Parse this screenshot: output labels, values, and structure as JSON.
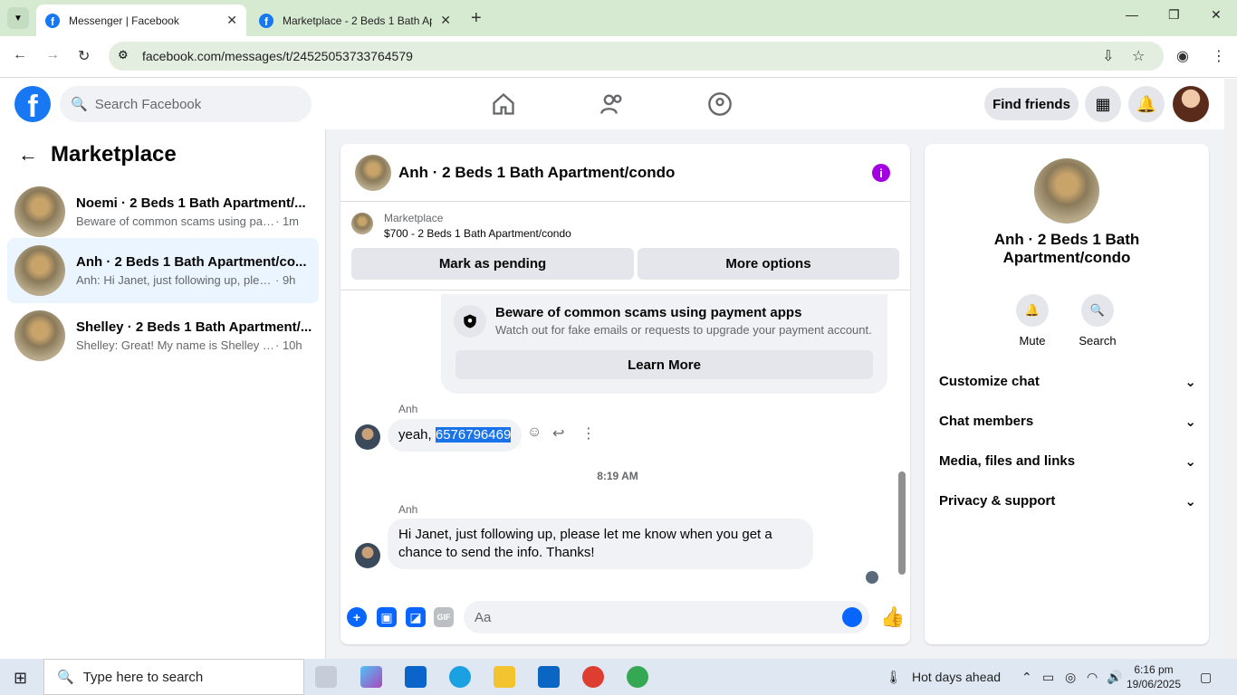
{
  "browser": {
    "tabs": [
      {
        "title": "Messenger | Facebook",
        "active": true
      },
      {
        "title": "Marketplace - 2 Beds 1 Bath Ap",
        "active": false
      }
    ],
    "url": "facebook.com/messages/t/24525053733764579"
  },
  "fb_header": {
    "search_placeholder": "Search Facebook",
    "find_friends": "Find friends"
  },
  "left": {
    "title": "Marketplace",
    "conversations": [
      {
        "name": "Noemi · 2 Beds 1 Bath Apartment/...",
        "preview": "Beware of common scams using pay...",
        "time": "· 1m",
        "selected": false
      },
      {
        "name": "Anh · 2 Beds 1 Bath Apartment/co...",
        "preview": "Anh: Hi Janet, just following up, pleas...",
        "time": "· 9h",
        "selected": true
      },
      {
        "name": "Shelley · 2 Beds 1 Bath Apartment/...",
        "preview": "Shelley: Great! My name is Shelley at...",
        "time": "· 10h",
        "selected": false
      }
    ]
  },
  "chat": {
    "title": "Anh · 2 Beds 1 Bath Apartment/condo",
    "marketplace_label": "Marketplace",
    "listing": "$700 - 2 Beds 1 Bath Apartment/condo",
    "mark_pending": "Mark as pending",
    "more_options": "More options",
    "scam_title": "Beware of common scams using payment apps",
    "scam_sub": "Watch out for fake emails or requests to upgrade your payment account.",
    "learn_more": "Learn More",
    "msg1_sender": "Anh",
    "msg1_prefix": "yeah, ",
    "msg1_selected": "6576796469",
    "timestamp": "8:19 AM",
    "msg2_sender": "Anh",
    "msg2_line1": "Hi Janet, just following up, please let me know when you get a",
    "msg2_line2": "chance to send the info. Thanks!",
    "composer_placeholder": "Aa"
  },
  "right": {
    "name_line1": "Anh · 2 Beds 1 Bath",
    "name_line2": "Apartment/condo",
    "mute": "Mute",
    "search": "Search",
    "sections": [
      "Customize chat",
      "Chat members",
      "Media, files and links",
      "Privacy & support"
    ]
  },
  "taskbar": {
    "search_placeholder": "Type here to search",
    "weather": "Hot days ahead",
    "time": "6:16 pm",
    "date": "19/06/2025"
  },
  "colors": {
    "accent": "#0866ff",
    "fb_blue": "#1877f2",
    "info_purple": "#a200e0"
  }
}
